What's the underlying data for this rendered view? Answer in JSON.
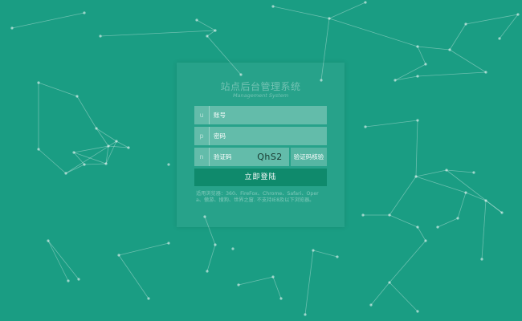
{
  "login": {
    "title": "站点后台管理系统",
    "subtitle": "Management System",
    "username": {
      "icon_glyph": "u",
      "placeholder": "账号",
      "value": ""
    },
    "password": {
      "icon_glyph": "p",
      "placeholder": "密码",
      "value": ""
    },
    "captcha_field": {
      "icon_glyph": "n",
      "placeholder": "验证码",
      "value": ""
    },
    "captcha_text": "QhS2",
    "verify_button": "验证码核验",
    "login_button": "立即登陆",
    "browser_note": "适用浏览器：360、FireFox、Chrome、Safari、Opera、傲游、搜狗、世界之窗. 不支持IE8及以下浏览器。"
  },
  "colors": {
    "background": "#1a9d83",
    "login_button": "#0f8a6c",
    "network_lines": "rgba(255,255,255,0.35)"
  }
}
